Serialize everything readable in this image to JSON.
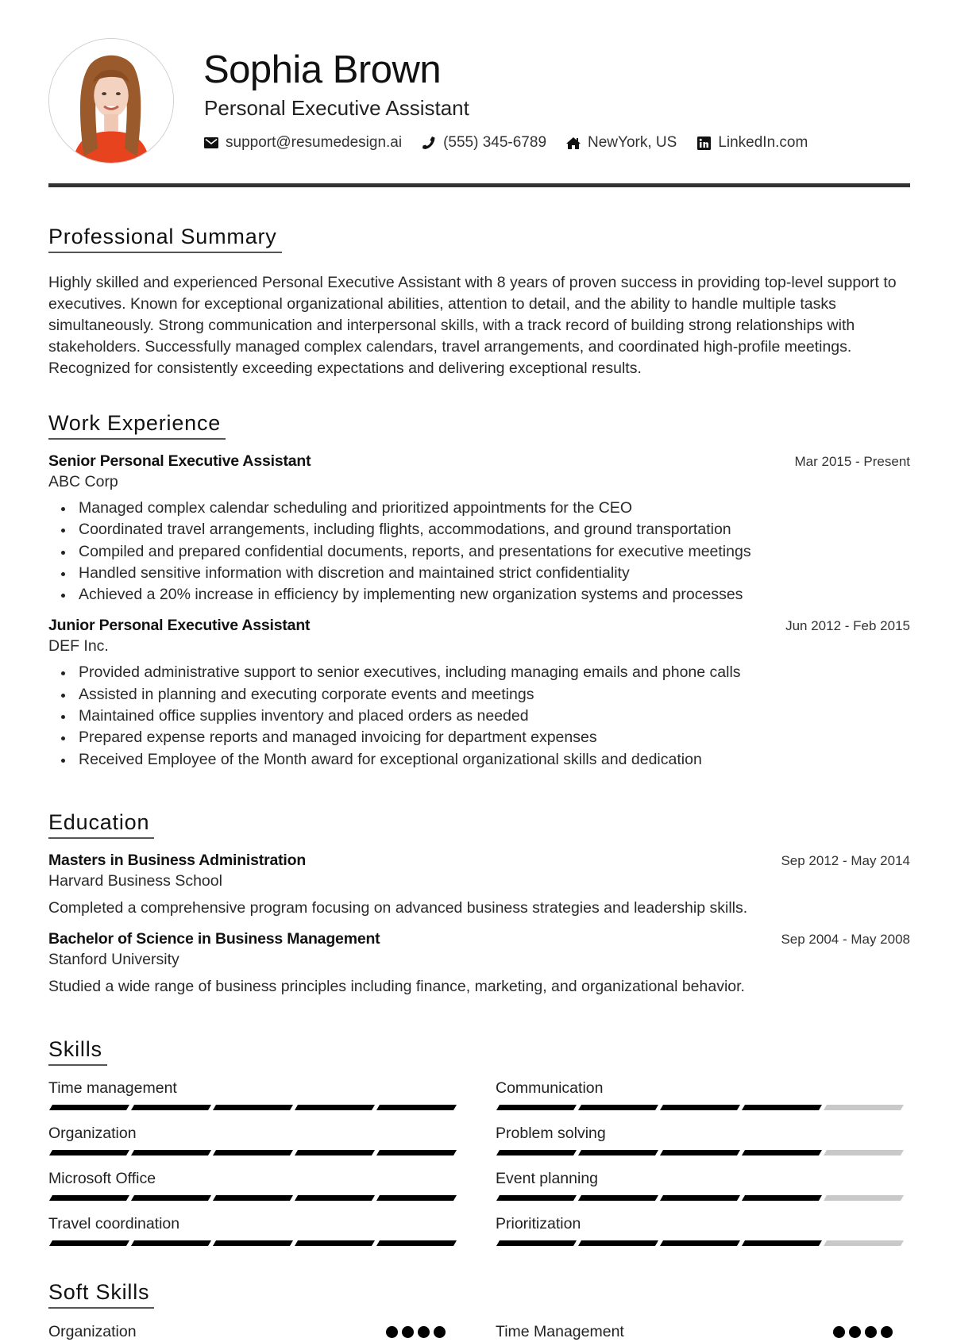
{
  "header": {
    "name": "Sophia Brown",
    "title": "Personal Executive Assistant",
    "contacts": [
      {
        "icon": "envelope-icon",
        "text": "support@resumedesign.ai"
      },
      {
        "icon": "phone-icon",
        "text": "(555) 345-6789"
      },
      {
        "icon": "home-icon",
        "text": "NewYork, US"
      },
      {
        "icon": "linkedin-icon",
        "text": "LinkedIn.com"
      }
    ]
  },
  "summary": {
    "heading": "Professional Summary",
    "text": "Highly skilled and experienced Personal Executive Assistant with 8 years of proven success in providing top-level support to executives. Known for exceptional organizational abilities, attention to detail, and the ability to handle multiple tasks simultaneously. Strong communication and interpersonal skills, with a track record of building strong relationships with stakeholders. Successfully managed complex calendars, travel arrangements, and coordinated high-profile meetings. Recognized for consistently exceeding expectations and delivering exceptional results."
  },
  "experience": {
    "heading": "Work Experience",
    "jobs": [
      {
        "title": "Senior Personal Executive Assistant",
        "company": "ABC Corp",
        "dates": "Mar 2015 - Present",
        "bullets": [
          "Managed complex calendar scheduling and prioritized appointments for the CEO",
          "Coordinated travel arrangements, including flights, accommodations, and ground transportation",
          "Compiled and prepared confidential documents, reports, and presentations for executive meetings",
          "Handled sensitive information with discretion and maintained strict confidentiality",
          "Achieved a 20% increase in efficiency by implementing new organization systems and processes"
        ]
      },
      {
        "title": "Junior Personal Executive Assistant",
        "company": "DEF Inc.",
        "dates": "Jun 2012 - Feb 2015",
        "bullets": [
          "Provided administrative support to senior executives, including managing emails and phone calls",
          "Assisted in planning and executing corporate events and meetings",
          "Maintained office supplies inventory and placed orders as needed",
          "Prepared expense reports and managed invoicing for department expenses",
          "Received Employee of the Month award for exceptional organizational skills and dedication"
        ]
      }
    ]
  },
  "education": {
    "heading": "Education",
    "items": [
      {
        "degree": "Masters in Business Administration",
        "school": "Harvard Business School",
        "dates": "Sep 2012 - May 2014",
        "description": "Completed a comprehensive program focusing on advanced business strategies and leadership skills."
      },
      {
        "degree": "Bachelor of Science in Business Management",
        "school": "Stanford University",
        "dates": "Sep 2004 - May 2008",
        "description": "Studied a wide range of business principles including finance, marketing, and organizational behavior."
      }
    ]
  },
  "skills": {
    "heading": "Skills",
    "max_level": 5,
    "items": [
      {
        "name": "Time management",
        "level": 5
      },
      {
        "name": "Communication",
        "level": 4
      },
      {
        "name": "Organization",
        "level": 5
      },
      {
        "name": "Problem solving",
        "level": 4
      },
      {
        "name": "Microsoft Office",
        "level": 5
      },
      {
        "name": "Event planning",
        "level": 4
      },
      {
        "name": "Travel coordination",
        "level": 5
      },
      {
        "name": "Prioritization",
        "level": 4
      }
    ]
  },
  "soft_skills": {
    "heading": "Soft Skills",
    "items": [
      {
        "name": "Organization",
        "level": 4,
        "max_level": 4
      },
      {
        "name": "Time Management",
        "level": 4,
        "max_level": 4
      }
    ]
  },
  "colors": {
    "text": "#222222",
    "accent": "#000000",
    "divider": "#333333",
    "bar_empty": "#c9c9c9"
  }
}
